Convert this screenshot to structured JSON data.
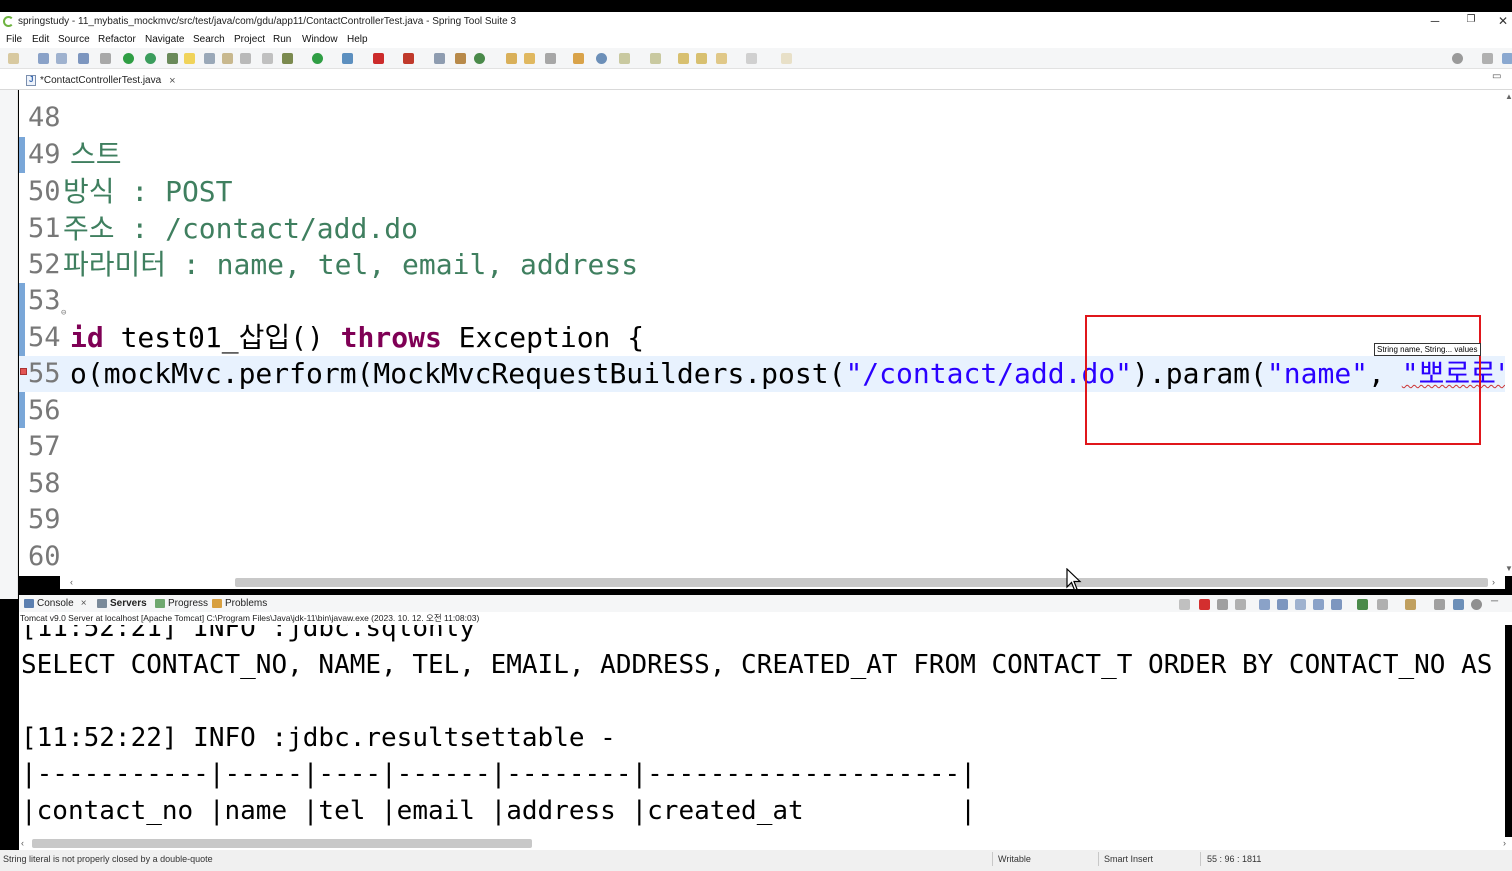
{
  "window": {
    "title": "springstudy - 11_mybatis_mockmvc/src/test/java/com/gdu/app11/ContactControllerTest.java - Spring Tool Suite 3",
    "minimize": "─",
    "maximize": "❐",
    "close": "✕"
  },
  "menu": [
    "File",
    "Edit",
    "Source",
    "Refactor",
    "Navigate",
    "Search",
    "Project",
    "Run",
    "Window",
    "Help"
  ],
  "editor": {
    "tab_label": "*ContactControllerTest.java",
    "lines": [
      {
        "n": "48",
        "text": ""
      },
      {
        "n": "49",
        "text": "스트"
      },
      {
        "n": "50",
        "text": "방식 : POST"
      },
      {
        "n": "51",
        "text": "주소 : /contact/add.do"
      },
      {
        "n": "52",
        "text": "파라미터 : name, tel, email, address"
      },
      {
        "n": "53",
        "text": ""
      },
      {
        "n": "54",
        "kw1": "id",
        "mid": " test01_삽입() ",
        "kw2": "throws",
        "rest": " Exception {"
      },
      {
        "n": "55",
        "a": "o(mockMvc.perform(MockMvcRequestBuilders.post(",
        "s1": "\"/contact/add.do\"",
        "b": ").param(",
        "s2": "\"name\"",
        "c": ", ",
        "s3": "\"뽀로로\"",
        "d": ")))"
      },
      {
        "n": "56",
        "text": ""
      },
      {
        "n": "57",
        "text": ""
      },
      {
        "n": "58",
        "text": ""
      },
      {
        "n": "59",
        "text": ""
      },
      {
        "n": "60",
        "text": ""
      }
    ],
    "tooltip": "String name, String... values"
  },
  "console": {
    "tabs": [
      "Console",
      "Servers",
      "Progress",
      "Problems"
    ],
    "status": "Tomcat v9.0 Server at localhost [Apache Tomcat] C:\\Program Files\\Java\\jdk-11\\bin\\javaw.exe  (2023. 10. 12. 오전 11:08:03)",
    "lines": [
      "[11:52:21] INFO :jdbc.sqlonly",
      "SELECT CONTACT_NO, NAME, TEL, EMAIL, ADDRESS, CREATED_AT FROM CONTACT_T ORDER BY CONTACT_NO AS",
      "",
      "[11:52:22] INFO :jdbc.resultsettable -",
      "|-----------|-----|----|------|--------|--------------------|",
      "|contact_no |name |tel |email |address |created_at          |"
    ]
  },
  "statusbar": {
    "message": "String literal is not properly closed by a double-quote",
    "writable": "Writable",
    "insert_mode": "Smart Insert",
    "position": "55 : 96 : 1811"
  },
  "colors": {
    "comment": "#3f7f5f",
    "keyword": "#7f0055",
    "string": "#2a00ff",
    "highlight_box": "#e0161b"
  }
}
